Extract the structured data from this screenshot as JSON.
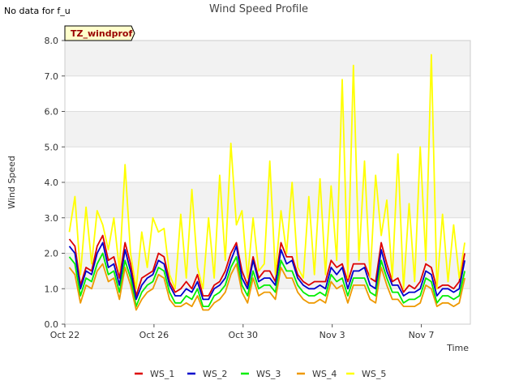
{
  "notice": "No data for f_u",
  "chart_data": {
    "type": "line",
    "title": "Wind Speed Profile",
    "xlabel": "Time",
    "ylabel": "Wind Speed",
    "ylim": [
      0,
      8
    ],
    "yticks": [
      "0.0",
      "1.0",
      "2.0",
      "3.0",
      "4.0",
      "5.0",
      "6.0",
      "7.0",
      "8.0"
    ],
    "xlim": [
      0,
      18.2
    ],
    "xticks": [
      {
        "value": 0,
        "label": "Oct 22"
      },
      {
        "value": 4,
        "label": "Oct 26"
      },
      {
        "value": 8,
        "label": "Oct 30"
      },
      {
        "value": 12,
        "label": "Nov 3"
      },
      {
        "value": 16,
        "label": "Nov 7"
      }
    ],
    "annotation": "TZ_windprof",
    "grid": true,
    "banded_background": true,
    "legend_position": "bottom",
    "x_start": 0.2,
    "x_step": 0.25,
    "series": [
      {
        "name": "WS_1",
        "color": "#dd0000",
        "values": [
          2.4,
          2.2,
          1.1,
          1.6,
          1.5,
          2.2,
          2.5,
          1.8,
          1.9,
          1.3,
          2.3,
          1.7,
          0.8,
          1.3,
          1.4,
          1.5,
          2.0,
          1.9,
          1.2,
          0.9,
          1.0,
          1.2,
          1.0,
          1.4,
          0.8,
          0.8,
          1.1,
          1.2,
          1.5,
          2.0,
          2.3,
          1.5,
          1.1,
          1.9,
          1.3,
          1.5,
          1.5,
          1.2,
          2.3,
          1.9,
          1.9,
          1.4,
          1.2,
          1.1,
          1.2,
          1.2,
          1.2,
          1.8,
          1.6,
          1.7,
          1.2,
          1.7,
          1.7,
          1.7,
          1.3,
          1.2,
          2.3,
          1.7,
          1.2,
          1.3,
          0.9,
          1.1,
          1.0,
          1.2,
          1.7,
          1.6,
          1.0,
          1.1,
          1.1,
          1.0,
          1.2,
          2.0
        ]
      },
      {
        "name": "WS_2",
        "color": "#0000cc",
        "values": [
          2.2,
          2.0,
          1.0,
          1.5,
          1.4,
          2.0,
          2.3,
          1.6,
          1.7,
          1.1,
          2.1,
          1.5,
          0.7,
          1.1,
          1.3,
          1.4,
          1.8,
          1.7,
          1.1,
          0.8,
          0.8,
          1.0,
          0.9,
          1.2,
          0.7,
          0.7,
          1.0,
          1.1,
          1.3,
          1.8,
          2.2,
          1.3,
          1.0,
          1.8,
          1.2,
          1.3,
          1.3,
          1.1,
          2.1,
          1.7,
          1.8,
          1.3,
          1.1,
          1.0,
          1.0,
          1.1,
          1.0,
          1.6,
          1.4,
          1.6,
          1.0,
          1.5,
          1.5,
          1.6,
          1.1,
          1.0,
          2.1,
          1.5,
          1.1,
          1.1,
          0.8,
          0.9,
          0.9,
          1.0,
          1.5,
          1.4,
          0.8,
          1.0,
          1.0,
          0.9,
          1.0,
          1.8
        ]
      },
      {
        "name": "WS_3",
        "color": "#00ee00",
        "values": [
          1.9,
          1.7,
          0.8,
          1.3,
          1.2,
          1.7,
          2.0,
          1.4,
          1.5,
          0.9,
          1.8,
          1.3,
          0.5,
          0.9,
          1.1,
          1.2,
          1.6,
          1.5,
          0.9,
          0.6,
          0.6,
          0.8,
          0.7,
          1.0,
          0.5,
          0.5,
          0.8,
          0.9,
          1.1,
          1.6,
          1.9,
          1.1,
          0.8,
          1.5,
          1.0,
          1.1,
          1.1,
          0.9,
          1.8,
          1.5,
          1.5,
          1.1,
          0.9,
          0.8,
          0.8,
          0.9,
          0.8,
          1.4,
          1.2,
          1.3,
          0.8,
          1.3,
          1.3,
          1.3,
          0.9,
          0.8,
          1.8,
          1.3,
          0.9,
          0.9,
          0.6,
          0.7,
          0.7,
          0.8,
          1.3,
          1.2,
          0.6,
          0.8,
          0.8,
          0.7,
          0.8,
          1.5
        ]
      },
      {
        "name": "WS_4",
        "color": "#ee9900",
        "values": [
          1.6,
          1.4,
          0.6,
          1.1,
          1.0,
          1.5,
          1.7,
          1.2,
          1.3,
          0.7,
          1.6,
          1.1,
          0.4,
          0.7,
          0.9,
          1.0,
          1.4,
          1.3,
          0.7,
          0.5,
          0.5,
          0.6,
          0.5,
          0.8,
          0.4,
          0.4,
          0.6,
          0.7,
          0.9,
          1.4,
          1.7,
          0.9,
          0.6,
          1.3,
          0.8,
          0.9,
          0.9,
          0.7,
          1.6,
          1.3,
          1.3,
          0.9,
          0.7,
          0.6,
          0.6,
          0.7,
          0.6,
          1.2,
          1.0,
          1.1,
          0.6,
          1.1,
          1.1,
          1.1,
          0.7,
          0.6,
          1.6,
          1.1,
          0.7,
          0.7,
          0.5,
          0.5,
          0.5,
          0.6,
          1.1,
          1.0,
          0.5,
          0.6,
          0.6,
          0.5,
          0.6,
          1.3
        ]
      },
      {
        "name": "WS_5",
        "color": "#ffff00",
        "values": [
          2.6,
          3.6,
          1.4,
          3.3,
          1.7,
          3.2,
          2.8,
          2.1,
          3.0,
          1.5,
          4.5,
          2.0,
          1.0,
          2.6,
          1.6,
          3.0,
          2.6,
          2.7,
          1.4,
          1.0,
          3.1,
          1.3,
          3.8,
          1.6,
          1.0,
          3.0,
          1.3,
          4.2,
          1.8,
          5.1,
          2.8,
          3.2,
          1.3,
          3.0,
          1.5,
          1.7,
          4.6,
          1.4,
          3.2,
          2.0,
          4.0,
          1.6,
          1.3,
          3.6,
          1.4,
          4.1,
          1.4,
          3.9,
          1.8,
          6.9,
          1.3,
          7.3,
          1.8,
          4.6,
          1.3,
          4.2,
          2.5,
          3.5,
          1.3,
          4.8,
          1.0,
          3.4,
          1.2,
          5.0,
          1.8,
          7.6,
          1.0,
          3.1,
          1.2,
          2.8,
          1.3,
          2.3
        ]
      }
    ]
  }
}
